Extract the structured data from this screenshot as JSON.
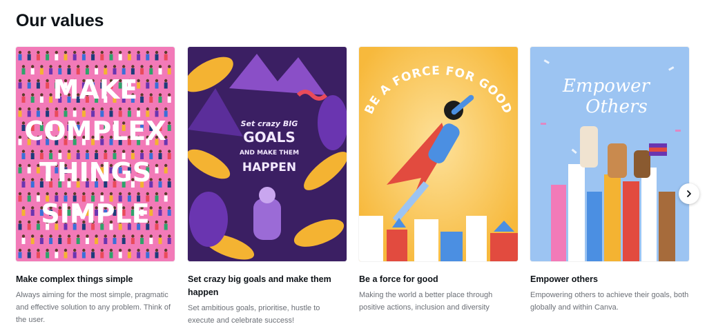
{
  "section": {
    "title": "Our values"
  },
  "cards": [
    {
      "title": "Make complex things simple",
      "description": "Always aiming for the most simple, pragmatic and effective solution to any problem. Think of the user.",
      "poster_lines": [
        "MAKE",
        "COMPLEX",
        "THINGS",
        "SIMPLE"
      ],
      "poster_bg": "#f27ab8"
    },
    {
      "title": "Set crazy big goals and make them happen",
      "description": "Set ambitious goals, prioritise, hustle to execute and celebrate success!",
      "poster_lines": [
        "Set crazy BIG",
        "GOALS",
        "AND MAKE THEM",
        "HAPPEN"
      ],
      "poster_bg": "#3b1f63"
    },
    {
      "title": "Be a force for good",
      "description": "Making the world a better place through positive actions, inclusion and diversity",
      "poster_lines": [
        "BE A FORCE FOR GOOD"
      ],
      "poster_bg": "#f7b93c"
    },
    {
      "title": "Empower others",
      "description": "Empowering others to achieve their goals, both globally and within Canva.",
      "poster_lines": [
        "Empower",
        "Others"
      ],
      "poster_bg": "#9cc4f2"
    }
  ],
  "carousel": {
    "next_icon": "chevron-right-icon"
  }
}
